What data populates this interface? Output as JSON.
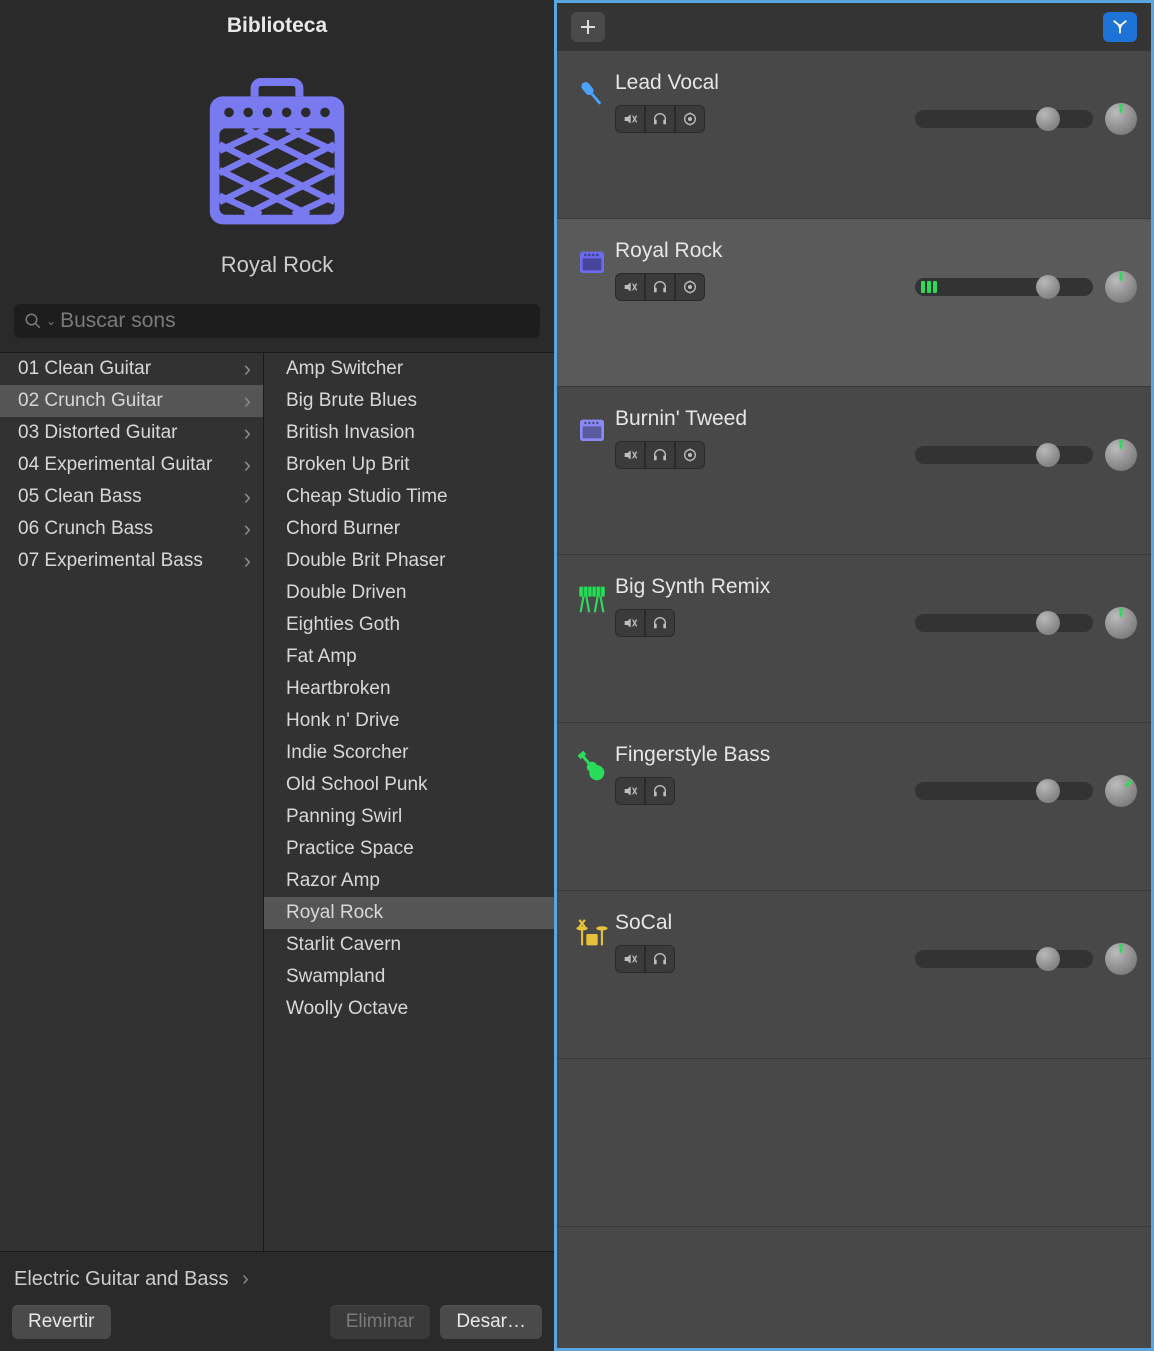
{
  "library": {
    "title": "Biblioteca",
    "selected_preset_name": "Royal Rock",
    "search_placeholder": "Buscar sons",
    "categories": [
      {
        "label": "01 Clean Guitar",
        "selected": false
      },
      {
        "label": "02 Crunch Guitar",
        "selected": true
      },
      {
        "label": "03 Distorted Guitar",
        "selected": false
      },
      {
        "label": "04 Experimental Guitar",
        "selected": false
      },
      {
        "label": "05 Clean Bass",
        "selected": false
      },
      {
        "label": "06 Crunch Bass",
        "selected": false
      },
      {
        "label": "07 Experimental Bass",
        "selected": false
      }
    ],
    "presets": [
      {
        "label": "Amp Switcher",
        "selected": false
      },
      {
        "label": "Big Brute Blues",
        "selected": false
      },
      {
        "label": "British Invasion",
        "selected": false
      },
      {
        "label": "Broken Up Brit",
        "selected": false
      },
      {
        "label": "Cheap Studio Time",
        "selected": false
      },
      {
        "label": "Chord Burner",
        "selected": false
      },
      {
        "label": "Double Brit Phaser",
        "selected": false
      },
      {
        "label": "Double Driven",
        "selected": false
      },
      {
        "label": "Eighties Goth",
        "selected": false
      },
      {
        "label": "Fat Amp",
        "selected": false
      },
      {
        "label": "Heartbroken",
        "selected": false
      },
      {
        "label": "Honk n' Drive",
        "selected": false
      },
      {
        "label": "Indie Scorcher",
        "selected": false
      },
      {
        "label": "Old School Punk",
        "selected": false
      },
      {
        "label": "Panning Swirl",
        "selected": false
      },
      {
        "label": "Practice Space",
        "selected": false
      },
      {
        "label": "Razor Amp",
        "selected": false
      },
      {
        "label": "Royal Rock",
        "selected": true
      },
      {
        "label": "Starlit Cavern",
        "selected": false
      },
      {
        "label": "Swampland",
        "selected": false
      },
      {
        "label": "Woolly Octave",
        "selected": false
      }
    ],
    "breadcrumb": "Electric Guitar and Bass",
    "buttons": {
      "revert": "Revertir",
      "delete": "Eliminar",
      "save": "Desar…"
    }
  },
  "tracks": [
    {
      "name": "Lead Vocal",
      "icon": "mic",
      "icon_color": "#4aa3ff",
      "selected": false,
      "has_input": true,
      "has_level": false
    },
    {
      "name": "Royal Rock",
      "icon": "amp",
      "icon_color": "#6b6bf0",
      "selected": true,
      "has_input": true,
      "has_level": true
    },
    {
      "name": "Burnin' Tweed",
      "icon": "amp",
      "icon_color": "#8a8af5",
      "selected": false,
      "has_input": true,
      "has_level": false
    },
    {
      "name": "Big Synth Remix",
      "icon": "keys",
      "icon_color": "#2bdc5a",
      "selected": false,
      "has_input": false,
      "has_level": false
    },
    {
      "name": "Fingerstyle Bass",
      "icon": "guitar",
      "icon_color": "#2bdc5a",
      "selected": false,
      "has_input": false,
      "has_level": false
    },
    {
      "name": "SoCal",
      "icon": "drums",
      "icon_color": "#e6c23a",
      "selected": false,
      "has_input": false,
      "has_level": false
    }
  ]
}
